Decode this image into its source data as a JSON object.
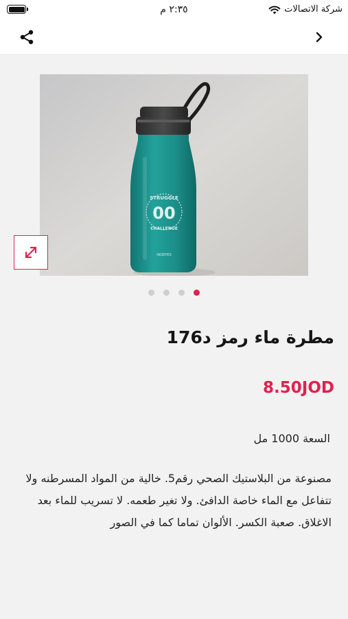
{
  "status_bar": {
    "carrier": "شركة الاتصالات",
    "time": "٢:٣٥ م"
  },
  "nav": {
    "share_icon": "share-icon",
    "back_icon": "chevron-right-icon"
  },
  "gallery": {
    "expand_icon": "expand-diagonal-icon",
    "image_count": 4,
    "active_index": 3
  },
  "product": {
    "title": "مطرة ماء رمز د176",
    "price": "8.50JOD",
    "capacity": "السعة 1000 مل",
    "description": "مصنوعة من البلاستيك الصحي رقم5. خالية من المواد المسرطنه ولا تتفاعل مع الماء خاصة الدافئ. ولا تغير طعمه. لا تسريب للماء بعد الاغلاق. صعبة الكسر. الألوان تماما كما في الصور"
  },
  "colors": {
    "accent": "#e0214f",
    "bottle": "#1a8a86"
  }
}
